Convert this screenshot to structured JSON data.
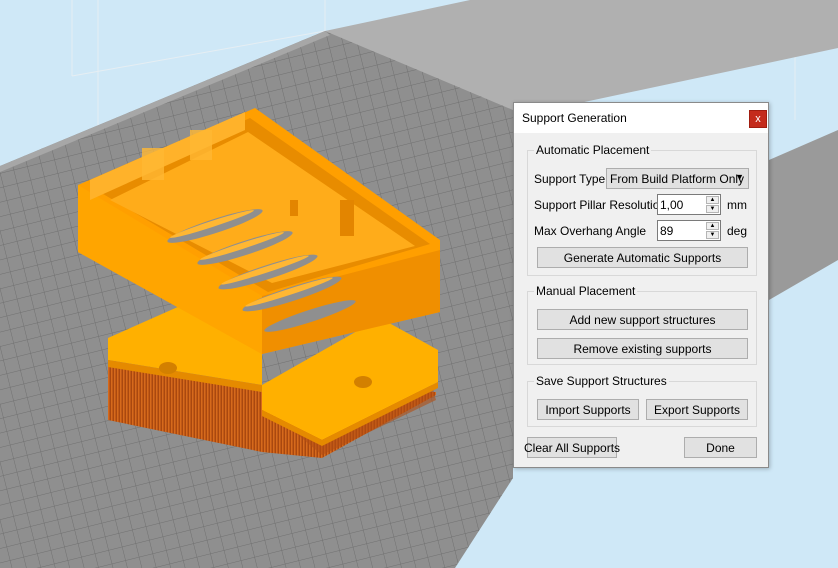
{
  "dialog": {
    "title": "Support Generation",
    "close_label": "x",
    "automatic": {
      "title": "Automatic Placement",
      "support_type_label": "Support Type",
      "support_type_value": "From Build Platform Only",
      "pillar_resolution_label": "Support Pillar Resolution",
      "pillar_resolution_value": "1,00",
      "pillar_resolution_unit": "mm",
      "overhang_label": "Max Overhang Angle",
      "overhang_value": "89",
      "overhang_unit": "deg",
      "generate_label": "Generate Automatic Supports"
    },
    "manual": {
      "title": "Manual Placement",
      "add_label": "Add new support structures",
      "remove_label": "Remove existing supports"
    },
    "save": {
      "title": "Save Support Structures",
      "import_label": "Import Supports",
      "export_label": "Export Supports"
    },
    "clear_label": "Clear All Supports",
    "done_label": "Done"
  },
  "colors": {
    "sky": "#cfe8f7",
    "platform": "#8c8c8c",
    "grid_line": "#6f6f6f",
    "part_orange": "#ff9f00",
    "support_brown": "#c05a17",
    "close_red": "#c42b1c"
  }
}
